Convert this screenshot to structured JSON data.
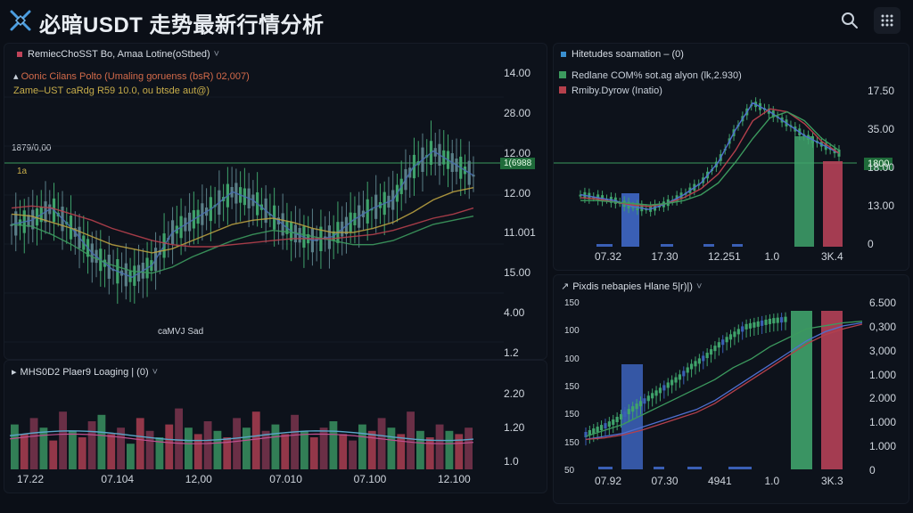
{
  "app": {
    "title": "必暗USDT 走势最新行情分析"
  },
  "icons": {
    "logo": "x-logo-icon",
    "search": "search-icon",
    "menu": "grid-menu-icon"
  },
  "colors": {
    "bull": "#3fa36b",
    "bear": "#c0445a",
    "blue": "#3a5fb5",
    "ma_red": "#b5404c",
    "ma_yellow": "#b8a040",
    "ma_blue": "#4a6fb0",
    "ma_green": "#3c9a5e"
  },
  "main_panel": {
    "title": "RemiecChoSST Bo, Amaa Lotine(oStbed)",
    "legend1": "Oonic Cilans Polto (Umaling goruenss (bsR) 02,007)",
    "legend2": "Zame–UST caRdg R59 10.0, ou btsde aut@)",
    "left_label": "1879/0,00",
    "small_label": "1a",
    "price_tag": "1(6988",
    "low_label": "caMVJ Sad",
    "y_ticks": [
      "14.00",
      "28.00",
      "12.00",
      "12.00",
      "11.001",
      "15.00",
      "4.00",
      "1.2"
    ]
  },
  "vol_panel": {
    "title": "MHS0D2 Plaer9 Loaging | (0)",
    "y_ticks": [
      "2.20",
      "1.20",
      "1.0"
    ],
    "x_ticks": [
      "17.22",
      "07.104",
      "12,00",
      "07.010",
      "07.100",
      "12.100"
    ]
  },
  "rt_panel": {
    "title": "Hitetudes soamation – (0)",
    "legend1": "Redlane COM% sot.ag alyon (lk,2.930)",
    "legend2": "Rmiby.Dyrow (Inatio)",
    "price_tag": "1800",
    "y_ticks": [
      "17.50",
      "35.00",
      "18.00",
      "13.00",
      "0"
    ],
    "x_ticks": [
      "07.32",
      "17.30",
      "12.251",
      "1.0",
      "3K.4"
    ]
  },
  "rb_panel": {
    "title": "Pixdis nebapies Hlane 5|r)|)",
    "left_ticks": [
      "150",
      "100",
      "100",
      "150",
      "150",
      "150",
      "50"
    ],
    "y_ticks": [
      "6.500",
      "0,300",
      "3,000",
      "1.000",
      "2.000",
      "1.000",
      "1.000",
      "0"
    ],
    "x_ticks": [
      "07.92",
      "07.30",
      "4941",
      "1.0",
      "3K.3"
    ]
  },
  "chart_data": [
    {
      "type": "line",
      "title": "RemiecChoSST Bo, Amaa Lotine(oStbed)",
      "ylim": [
        0,
        14
      ],
      "series": [
        {
          "values": [
            6,
            6.2,
            6.8,
            5.8,
            4.6,
            3.8,
            3.4,
            4.0,
            5.6,
            6.2,
            6.8,
            7.6,
            7.2,
            6.4,
            5.6,
            5.2,
            5.4,
            6.2,
            6.8,
            7.2,
            8.8,
            9.6,
            9.0,
            8.4
          ]
        },
        {
          "values": [
            6.5,
            6.4,
            6.1,
            5.8,
            5.4,
            5.0,
            4.8,
            4.6,
            4.8,
            5.2,
            5.6,
            6.0,
            6.2,
            6.3,
            6.1,
            5.8,
            5.6,
            5.6,
            5.8,
            6.1,
            6.6,
            7.2,
            7.6,
            7.8
          ]
        },
        {
          "values": [
            6.0,
            5.9,
            5.5,
            5.0,
            4.4,
            4.0,
            3.7,
            3.6,
            3.9,
            4.4,
            4.8,
            5.2,
            5.5,
            5.7,
            5.6,
            5.4,
            5.2,
            5.0,
            5.0,
            5.2,
            5.6,
            6.0,
            6.2,
            6.4
          ]
        },
        {
          "values": [
            6.8,
            6.9,
            6.8,
            6.5,
            6.2,
            5.8,
            5.5,
            5.2,
            5.0,
            4.9,
            4.9,
            5.0,
            5.1,
            5.2,
            5.3,
            5.3,
            5.3,
            5.4,
            5.5,
            5.7,
            6.0,
            6.3,
            6.5,
            6.8
          ]
        }
      ]
    },
    {
      "type": "bar",
      "title": "MHS0D2 Plaer9 Loaging | (0)",
      "values": [
        1.4,
        1.1,
        1.6,
        1.3,
        0.9,
        1.8,
        1.2,
        1.0,
        1.5,
        1.7,
        1.1,
        1.3,
        0.8,
        1.6,
        1.2,
        1.0,
        1.4,
        1.9,
        1.3,
        1.1,
        1.5,
        1.2,
        1.0,
        1.6,
        1.3,
        1.8,
        1.2,
        1.4,
        1.1,
        1.7,
        1.2,
        1.0,
        1.3,
        1.5,
        1.1,
        0.9,
        1.4,
        1.2,
        1.6,
        1.3,
        1.1,
        1.8,
        1.2,
        1.0,
        1.4,
        1.2,
        1.1,
        1.3
      ]
    },
    {
      "type": "line",
      "title": "Hitetudes soamation – (0)",
      "x": [
        "07.32",
        "17.30",
        "12.251",
        "1.0",
        "3K.4"
      ],
      "series": [
        {
          "values": [
            3.4,
            3.2,
            3.0,
            2.6,
            2.4,
            2.8,
            3.4,
            4.2,
            5.6,
            7.8,
            9.6,
            9.0,
            8.2,
            7.4,
            6.8,
            6.2
          ]
        },
        {
          "values": [
            3.2,
            3.1,
            2.9,
            2.7,
            2.6,
            2.8,
            3.2,
            3.8,
            4.8,
            6.4,
            8.4,
            9.2,
            9.0,
            8.2,
            7.0,
            6.2
          ]
        },
        {
          "values": [
            3.0,
            3.0,
            2.9,
            2.8,
            2.7,
            2.8,
            3.0,
            3.4,
            4.2,
            5.6,
            7.2,
            8.6,
            9.0,
            8.4,
            7.2,
            6.4
          ]
        }
      ]
    },
    {
      "type": "line",
      "title": "Pixdis nebapies Hlane 5|r)|)",
      "x": [
        "07.92",
        "07.30",
        "4941",
        "1.0",
        "3K.3"
      ],
      "series": [
        {
          "values": [
            2.2,
            2.6,
            3.0,
            3.6,
            4.2,
            4.8,
            5.4,
            6.0,
            6.8,
            7.4,
            8.2,
            8.8,
            9.4,
            9.6,
            9.8,
            9.9
          ]
        },
        {
          "values": [
            2.0,
            2.2,
            2.4,
            2.8,
            3.2,
            3.6,
            4.0,
            4.6,
            5.4,
            6.2,
            7.0,
            7.8,
            8.6,
            9.2,
            9.6,
            9.8
          ]
        },
        {
          "values": [
            2.0,
            2.1,
            2.3,
            2.6,
            3.0,
            3.4,
            3.8,
            4.4,
            5.2,
            6.0,
            6.8,
            7.6,
            8.4,
            9.0,
            9.4,
            9.7
          ]
        }
      ]
    }
  ]
}
